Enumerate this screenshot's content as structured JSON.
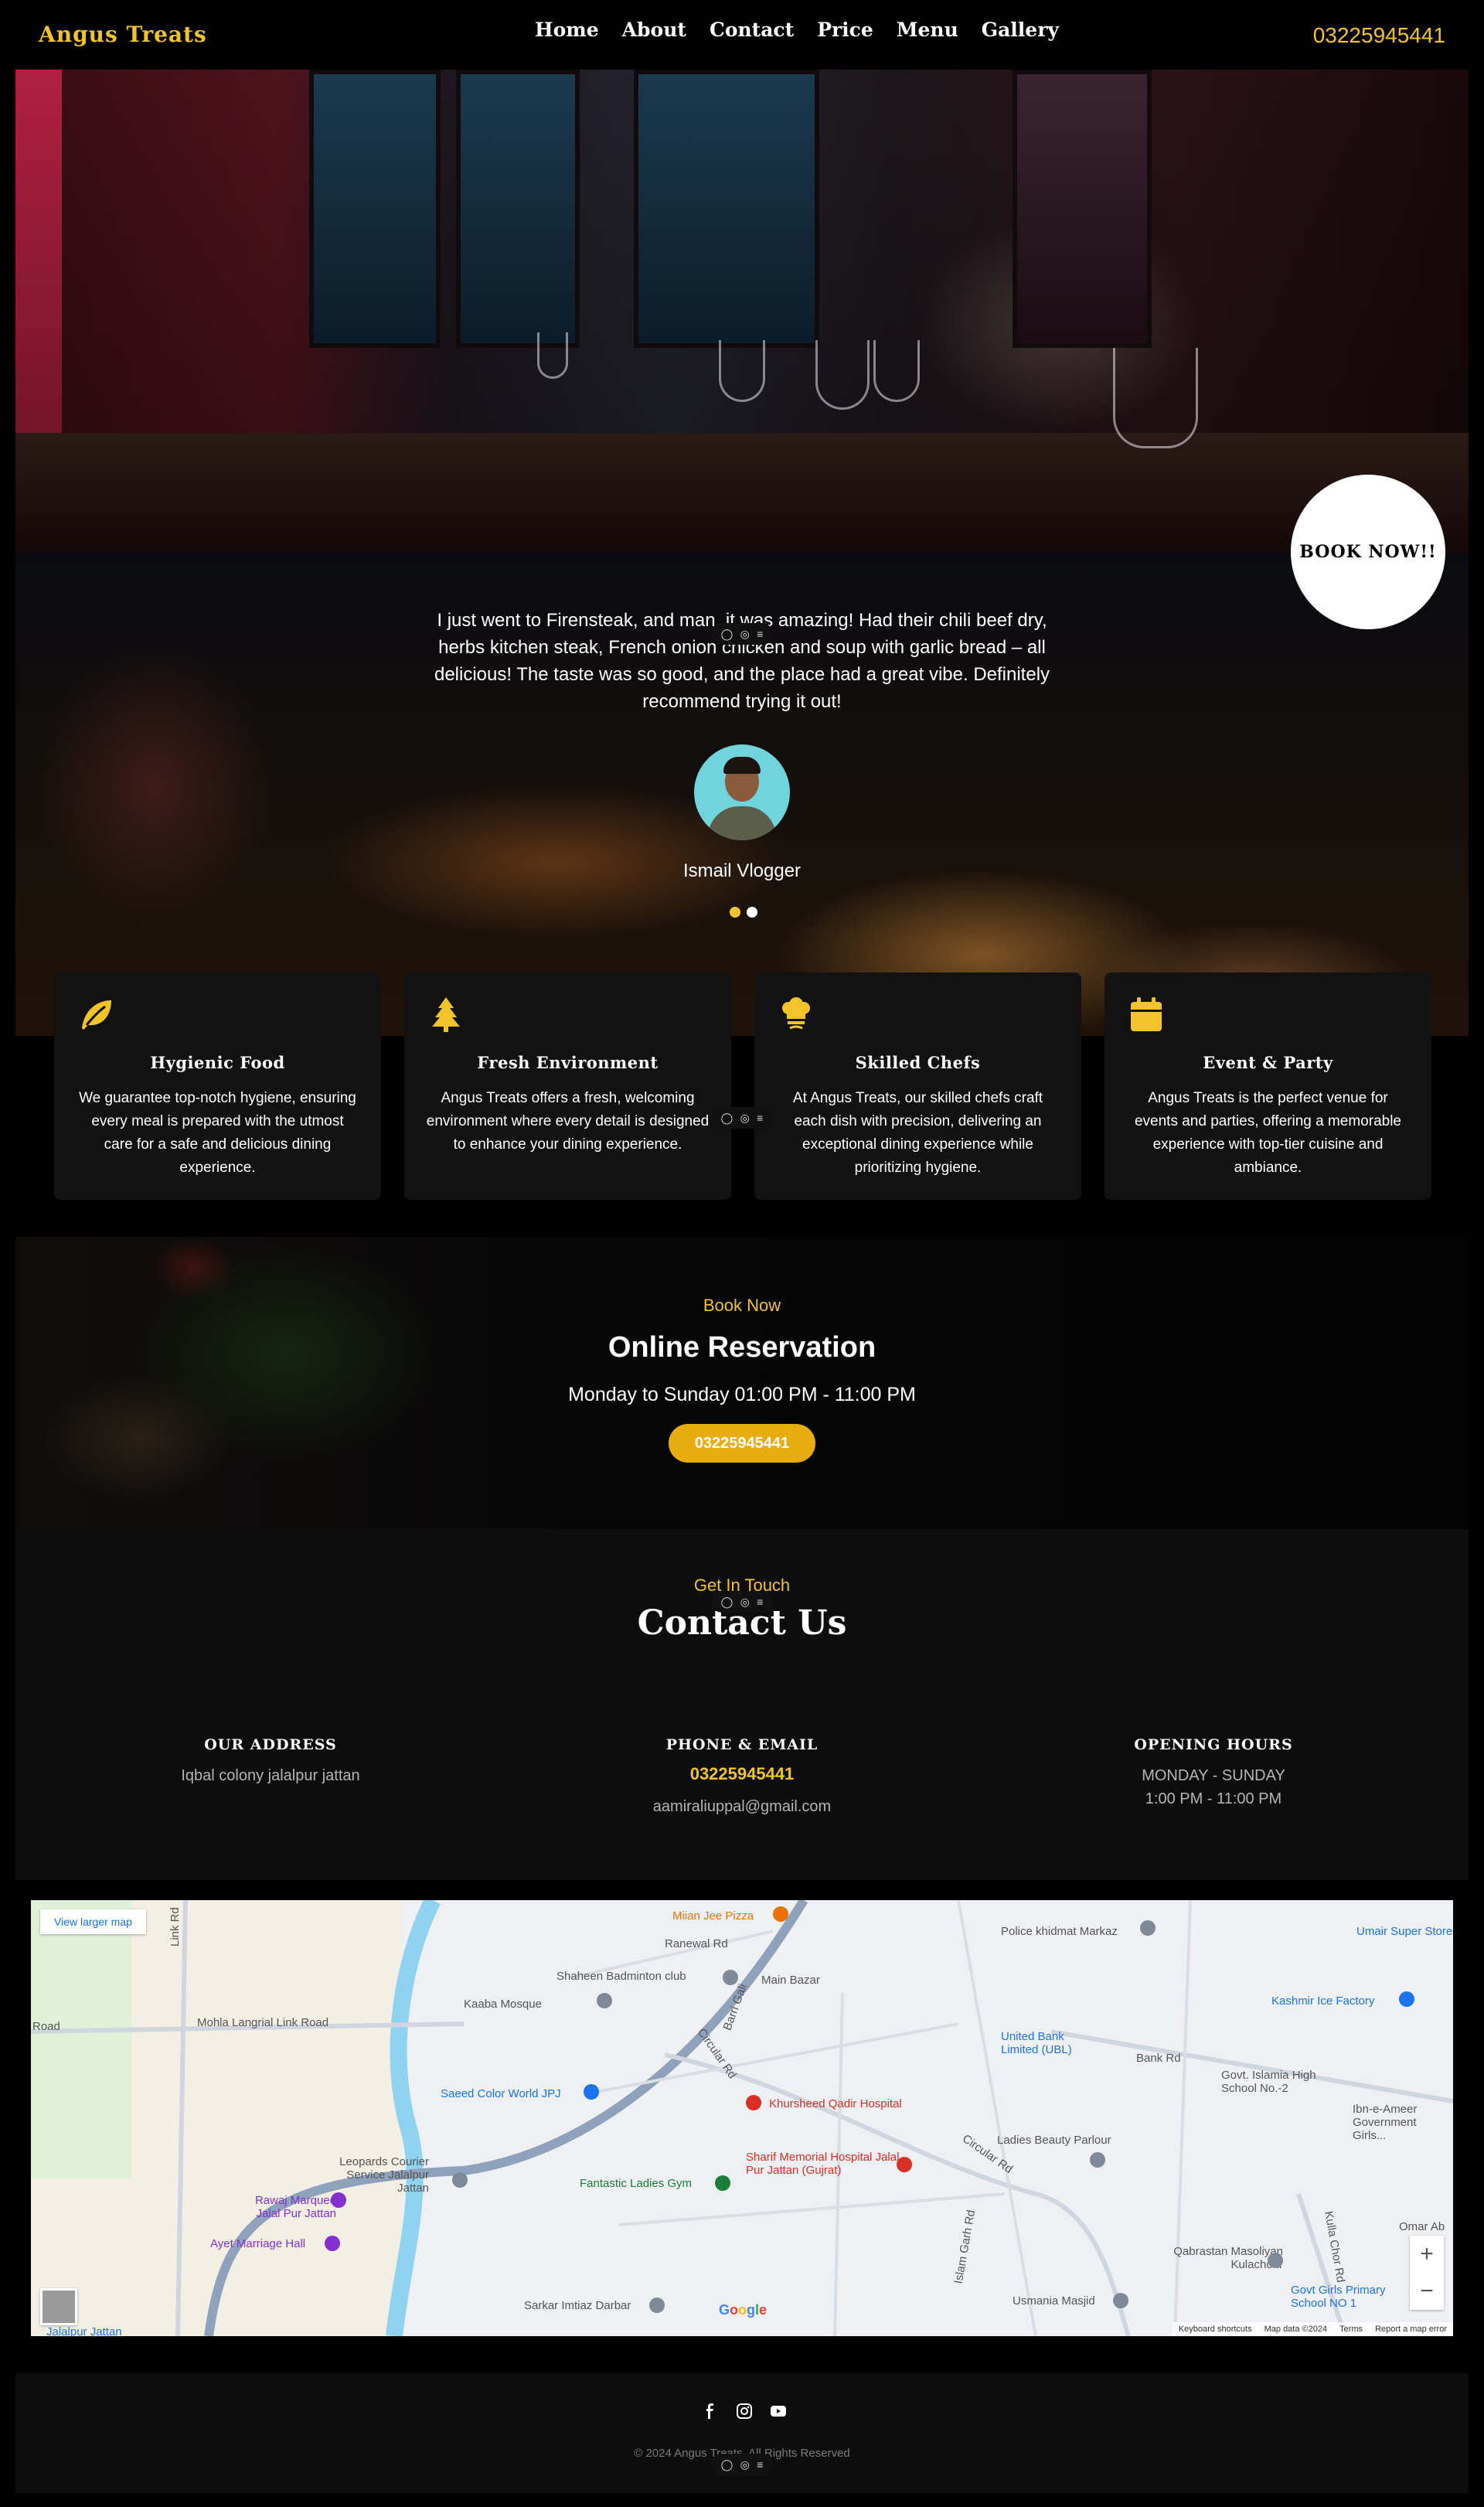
{
  "nav": {
    "brand": "Angus Treats",
    "links": [
      "Home",
      "About",
      "Contact",
      "Price",
      "Menu",
      "Gallery"
    ],
    "phone": "03225945441"
  },
  "hero": {
    "book_button": "BOOK NOW!!"
  },
  "testimonial": {
    "quote": "I just went to Firensteak, and man, it was amazing! Had their chili beef dry, herbs kitchen steak, French onion chicken and soup with garlic bread – all delicious! The taste was so good, and the place had a great vibe. Definitely recommend trying it out!",
    "name": "Ismail Vlogger"
  },
  "features": [
    {
      "icon": "leaf-icon",
      "title": "Hygienic Food",
      "text": "We guarantee top-notch hygiene, ensuring every meal is prepared with the utmost care for a safe and delicious dining experience."
    },
    {
      "icon": "tree-icon",
      "title": "Fresh Environment",
      "text": "Angus Treats offers a fresh, welcoming environment where every detail is designed to enhance your dining experience."
    },
    {
      "icon": "chef-hat-icon",
      "title": "Skilled Chefs",
      "text": "At Angus Treats, our skilled chefs craft each dish with precision, delivering an exceptional dining experience while prioritizing hygiene."
    },
    {
      "icon": "calendar-icon",
      "title": "Event & Party",
      "text": "Angus Treats is the perfect venue for events and parties, offering a memorable experience with top-tier cuisine and ambiance."
    }
  ],
  "reservation": {
    "kicker": "Book Now",
    "title": "Online Reservation",
    "hours": "Monday to Sunday 01:00 PM - 11:00 PM",
    "button": "03225945441"
  },
  "contact": {
    "kicker": "Get In Touch",
    "title": "Contact Us",
    "address": {
      "heading": "OUR ADDRESS",
      "value": "Iqbal colony jalalpur jattan"
    },
    "phone_email": {
      "heading": "PHONE & EMAIL",
      "phone": "03225945441",
      "email": "aamiraliuppal@gmail.com"
    },
    "hours": {
      "heading": "OPENING HOURS",
      "days": "MONDAY - SUNDAY",
      "time": "1:00 PM - 11:00 PM"
    }
  },
  "map": {
    "larger_link": "View larger map",
    "places": [
      "Miian Jee Pizza",
      "Police khidmat Markaz",
      "Umair Super Store",
      "Ranewal Rd",
      "Shaheen Badminton club",
      "Main Bazar",
      "Kaaba Mosque",
      "Kashmir Ice Factory",
      "Mohla Langrial Link Road",
      "Road",
      "United Bank Limited (UBL)",
      "Bank Rd",
      "Govt. Islamia High School No.-2",
      "Saeed Color World JPJ",
      "Khursheed Qadir Hospital",
      "Ibn-e-Ameer Government Girls...",
      "Ladies Beauty Parlour",
      "Leopards Courier Service Jalalpur Jattan",
      "Sharif Memorial Hospital Jalal Pur Jattan (Gujrat)",
      "Fantastic Ladies Gym",
      "Rawaj Marquee Jalal Pur Jattan",
      "Ayet Marriage Hall",
      "Qabrastan Masoliyan Kulachour",
      "Omar Ab",
      "Govt Girls Primary School NO 1",
      "Usmania Masjid",
      "Sarkar Imtiaz Darbar",
      "Link Rd",
      "Circular Rd",
      "Barri Gali",
      "Islam Garh Rd",
      "Kulla Chor Rd",
      "Jalalpur Jattan"
    ],
    "footer": [
      "Keyboard shortcuts",
      "Map data ©2024",
      "Terms",
      "Report a map error"
    ],
    "google": "Google",
    "zoom_in": "+",
    "zoom_out": "−"
  },
  "footer": {
    "social": [
      "facebook-icon",
      "instagram-icon",
      "youtube-icon"
    ],
    "copyright": "© 2024 Angus Treats. All Rights Reserved"
  },
  "colors": {
    "accent": "#f2c42a",
    "button": "#e8ac0c",
    "card": "#121212",
    "background": "#000000"
  }
}
